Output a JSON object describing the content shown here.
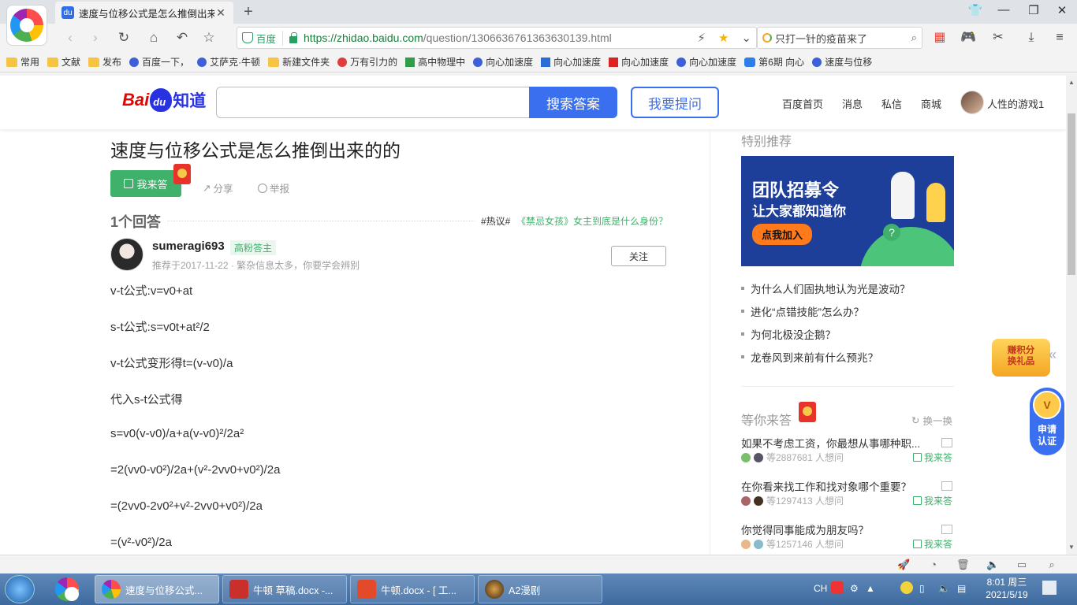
{
  "browser": {
    "tab_title": "速度与位移公式是怎么推倒出来",
    "url_cert": "百度",
    "url_host": "https://zhidao.baidu.com",
    "url_path": "/question/1306636761363630139.html",
    "search_text": "只打一针的疫苗来了",
    "bookmarks": [
      "常用",
      "文献",
      "发布",
      "百度一下，",
      "艾萨克·牛顿",
      "新建文件夹",
      "万有引力的",
      "高中物理中",
      "向心加速度",
      "向心加速度",
      "向心加速度",
      "向心加速度",
      "第6期 向心",
      "速度与位移"
    ]
  },
  "zhidao": {
    "logo_bai": "Bai",
    "logo_zhidao": "知道",
    "search_btn": "搜索答案",
    "ask_btn": "我要提问",
    "nav": [
      "百度首页",
      "消息",
      "私信",
      "商城"
    ],
    "username": "人性的游戏1"
  },
  "question": {
    "title": "速度与位移公式是怎么推倒出来的的",
    "answer_btn": "我来答",
    "share": "分享",
    "report": "举报",
    "answer_count": "1个回答",
    "hot_tag": "#热议#",
    "hot_link": "《禁忌女孩》女主到底是什么身份？"
  },
  "answer": {
    "name": "sumeragi693",
    "badge": "高粉答主",
    "date": "推荐于2017-11-22 · 繁杂信息太多，你要学会辨别",
    "follow": "关注",
    "lines": [
      "v-t公式:v=v0+at",
      "s-t公式:s=v0t+at²/2",
      "v-t公式变形得t=(v-v0)/a",
      "代入s-t公式得",
      "s=v0(v-v0)/a+a(v-v0)²/2a²",
      "=2(vv0-v0²)/2a+(v²-2vv0+v0²)/2a",
      "=(2vv0-2v0²+v²-2vv0+v0²)/2a",
      "=(v²-v0²)/2a"
    ]
  },
  "sidebar": {
    "title": "特别推荐",
    "banner_line1": "团队招募令",
    "banner_line2": "让大家都知道你",
    "banner_btn": "点我加入",
    "links": [
      "为什么人们固执地认为光是波动？",
      "进化“点错技能”怎么办？",
      "为何北极没企鹅？",
      "龙卷风到来前有什么预兆？"
    ],
    "wait_title": "等你来答",
    "refresh": "换一换",
    "wait_questions": [
      {
        "q": "如果不考虑工资，你最想从事哪种职...",
        "meta": "等2887681 人想问",
        "ans": "我来答"
      },
      {
        "q": "在你看来找工作和找对象哪个重要？",
        "meta": "等1297413 人想问",
        "ans": "我来答"
      },
      {
        "q": "你觉得同事能成为朋友吗？",
        "meta": "等1257146 人想问",
        "ans": "我来答"
      }
    ],
    "float_earn": "赚积分\n换礼品",
    "float_cert": "申请\n认证",
    "float_cert_medal": "V"
  },
  "taskbar": {
    "items": [
      "速度与位移公式...",
      "牛顿 草稿.docx -...",
      "牛顿.docx - [ 工...",
      "A2漫剧"
    ],
    "ime": "CH",
    "time": "8:01 周三",
    "date": "2021/5/19"
  }
}
